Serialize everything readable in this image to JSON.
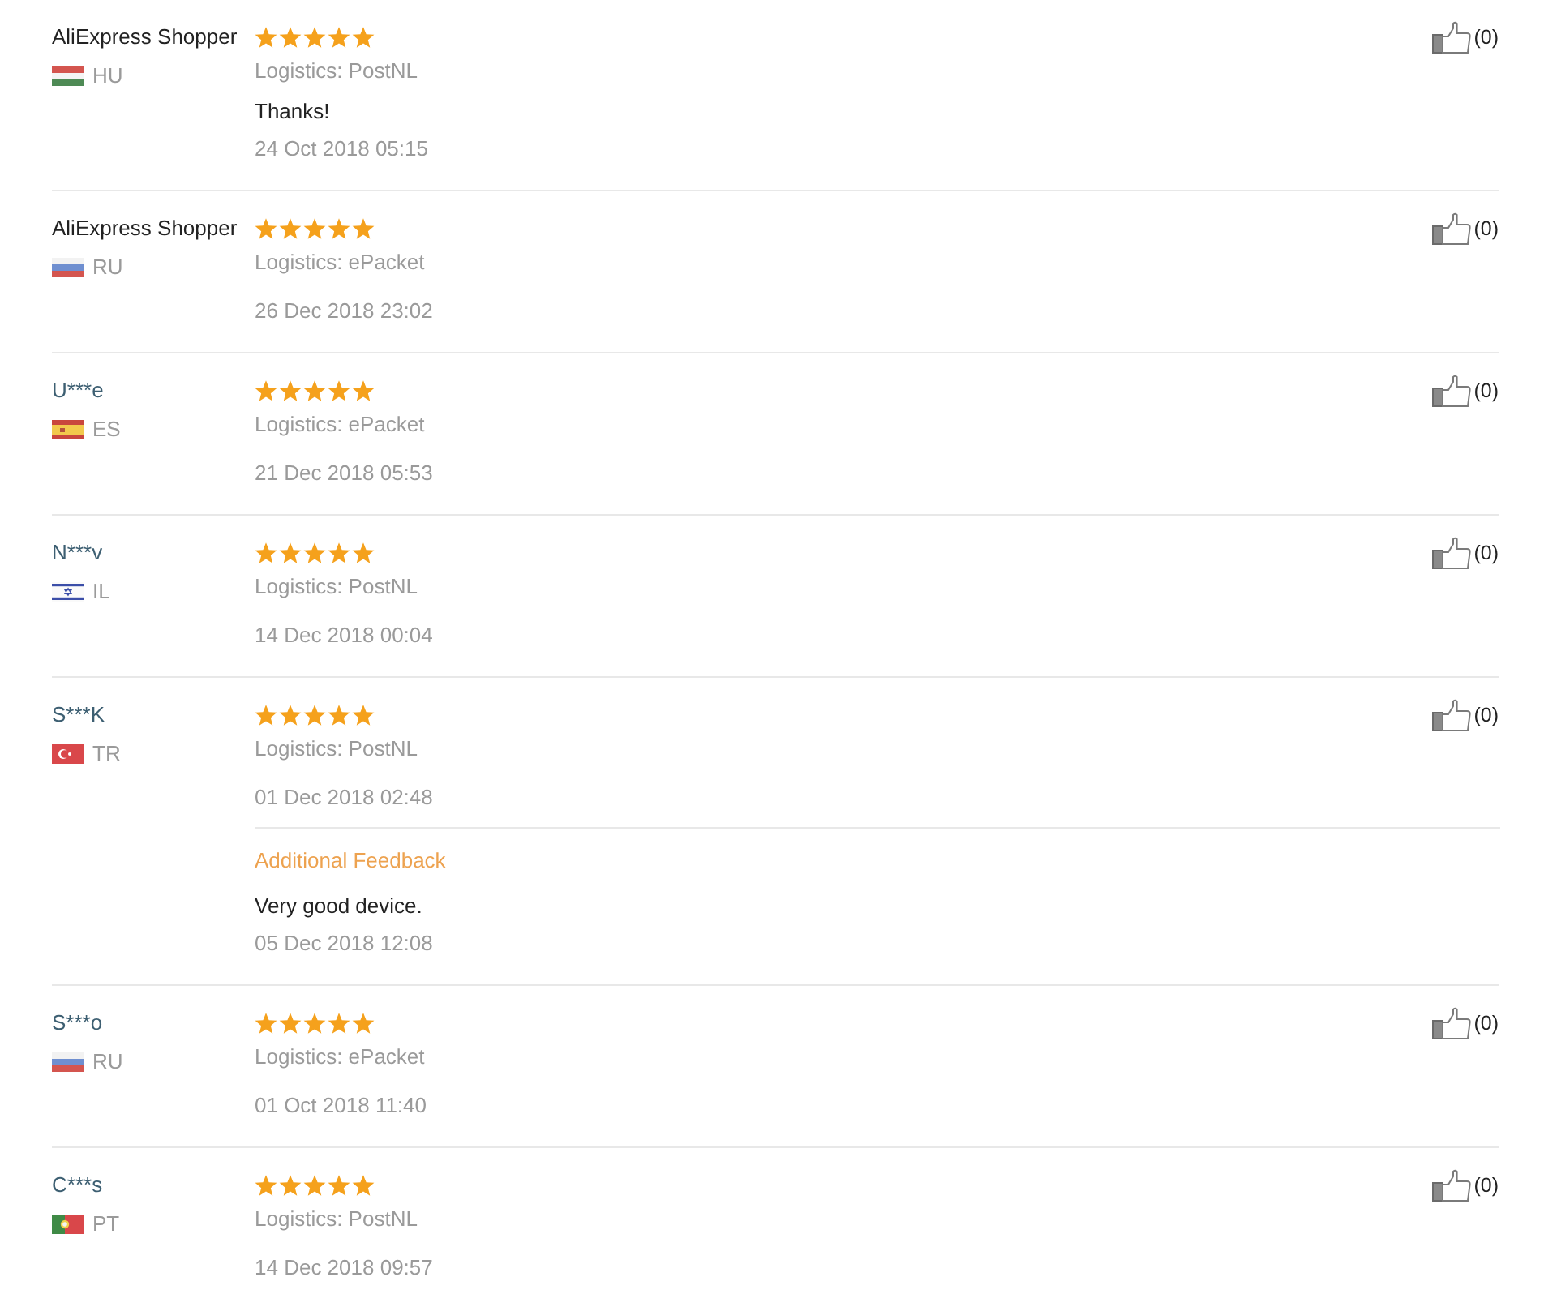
{
  "reviews": [
    {
      "reviewer": {
        "name": "AliExpress Shopper",
        "linked": false
      },
      "country": {
        "code": "HU",
        "kind": "hungary"
      },
      "stars": 5,
      "logistics": "Logistics: PostNL",
      "comment": "Thanks!",
      "date": "24 Oct 2018 05:15",
      "likes": "(0)"
    },
    {
      "reviewer": {
        "name": "AliExpress Shopper",
        "linked": false
      },
      "country": {
        "code": "RU",
        "kind": "russia"
      },
      "stars": 5,
      "logistics": "Logistics: ePacket",
      "date": "26 Dec 2018 23:02",
      "likes": "(0)"
    },
    {
      "reviewer": {
        "name": "U***e",
        "linked": true
      },
      "country": {
        "code": "ES",
        "kind": "spain"
      },
      "stars": 5,
      "logistics": "Logistics: ePacket",
      "date": "21 Dec 2018 05:53",
      "likes": "(0)"
    },
    {
      "reviewer": {
        "name": "N***v",
        "linked": true
      },
      "country": {
        "code": "IL",
        "kind": "israel"
      },
      "stars": 5,
      "logistics": "Logistics: PostNL",
      "date": "14 Dec 2018 00:04",
      "likes": "(0)"
    },
    {
      "reviewer": {
        "name": "S***K",
        "linked": true
      },
      "country": {
        "code": "TR",
        "kind": "turkey"
      },
      "stars": 5,
      "logistics": "Logistics: PostNL",
      "date": "01 Dec 2018 02:48",
      "likes": "(0)",
      "additional_feedback": {
        "label": "Additional Feedback",
        "comment": "Very good device.",
        "date": "05 Dec 2018 12:08"
      }
    },
    {
      "reviewer": {
        "name": "S***o",
        "linked": true
      },
      "country": {
        "code": "RU",
        "kind": "russia"
      },
      "stars": 5,
      "logistics": "Logistics: ePacket",
      "date": "01 Oct 2018 11:40",
      "likes": "(0)"
    },
    {
      "reviewer": {
        "name": "C***s",
        "linked": true
      },
      "country": {
        "code": "PT",
        "kind": "portugal"
      },
      "stars": 5,
      "logistics": "Logistics: PostNL",
      "date": "14 Dec 2018 09:57",
      "likes": "(0)"
    }
  ]
}
